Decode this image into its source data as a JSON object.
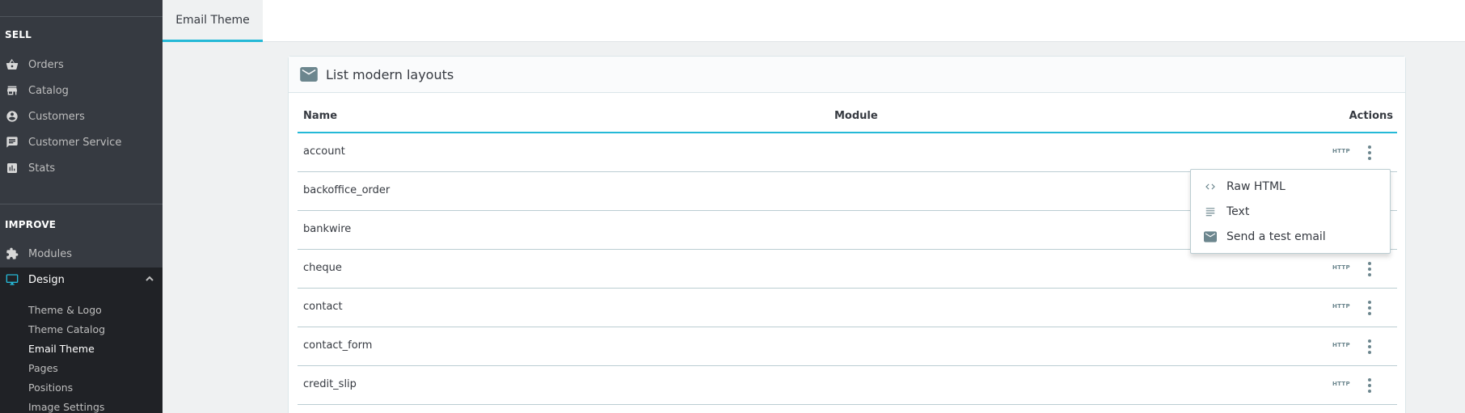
{
  "sidebar": {
    "sections": {
      "sell": "SELL",
      "improve": "IMPROVE"
    },
    "sell_items": [
      {
        "label": "Orders",
        "icon": "basket-icon"
      },
      {
        "label": "Catalog",
        "icon": "store-icon"
      },
      {
        "label": "Customers",
        "icon": "account-circle-icon"
      },
      {
        "label": "Customer Service",
        "icon": "chat-icon"
      },
      {
        "label": "Stats",
        "icon": "chart-icon"
      }
    ],
    "improve_items": [
      {
        "label": "Modules",
        "icon": "puzzle-icon"
      },
      {
        "label": "Design",
        "icon": "desktop-icon"
      }
    ],
    "design_sub": [
      {
        "label": "Theme & Logo"
      },
      {
        "label": "Theme Catalog"
      },
      {
        "label": "Email Theme"
      },
      {
        "label": "Pages"
      },
      {
        "label": "Positions"
      },
      {
        "label": "Image Settings"
      }
    ]
  },
  "tabs": [
    {
      "label": "Email Theme"
    }
  ],
  "card": {
    "title": "List modern layouts",
    "columns": {
      "name": "Name",
      "module": "Module",
      "actions": "Actions"
    },
    "http_label": "HTTP",
    "rows": [
      {
        "name": "account",
        "module": ""
      },
      {
        "name": "backoffice_order",
        "module": ""
      },
      {
        "name": "bankwire",
        "module": ""
      },
      {
        "name": "cheque",
        "module": ""
      },
      {
        "name": "contact",
        "module": ""
      },
      {
        "name": "contact_form",
        "module": ""
      },
      {
        "name": "credit_slip",
        "module": ""
      }
    ]
  },
  "dropdown": {
    "items": [
      {
        "label": "Raw HTML",
        "icon": "code-icon"
      },
      {
        "label": "Text",
        "icon": "text-lines-icon"
      },
      {
        "label": "Send a test email",
        "icon": "mail-icon"
      }
    ]
  },
  "colors": {
    "accent": "#25b9d7",
    "sidebar_bg": "#363a41",
    "sidebar_active_bg": "#202226"
  }
}
